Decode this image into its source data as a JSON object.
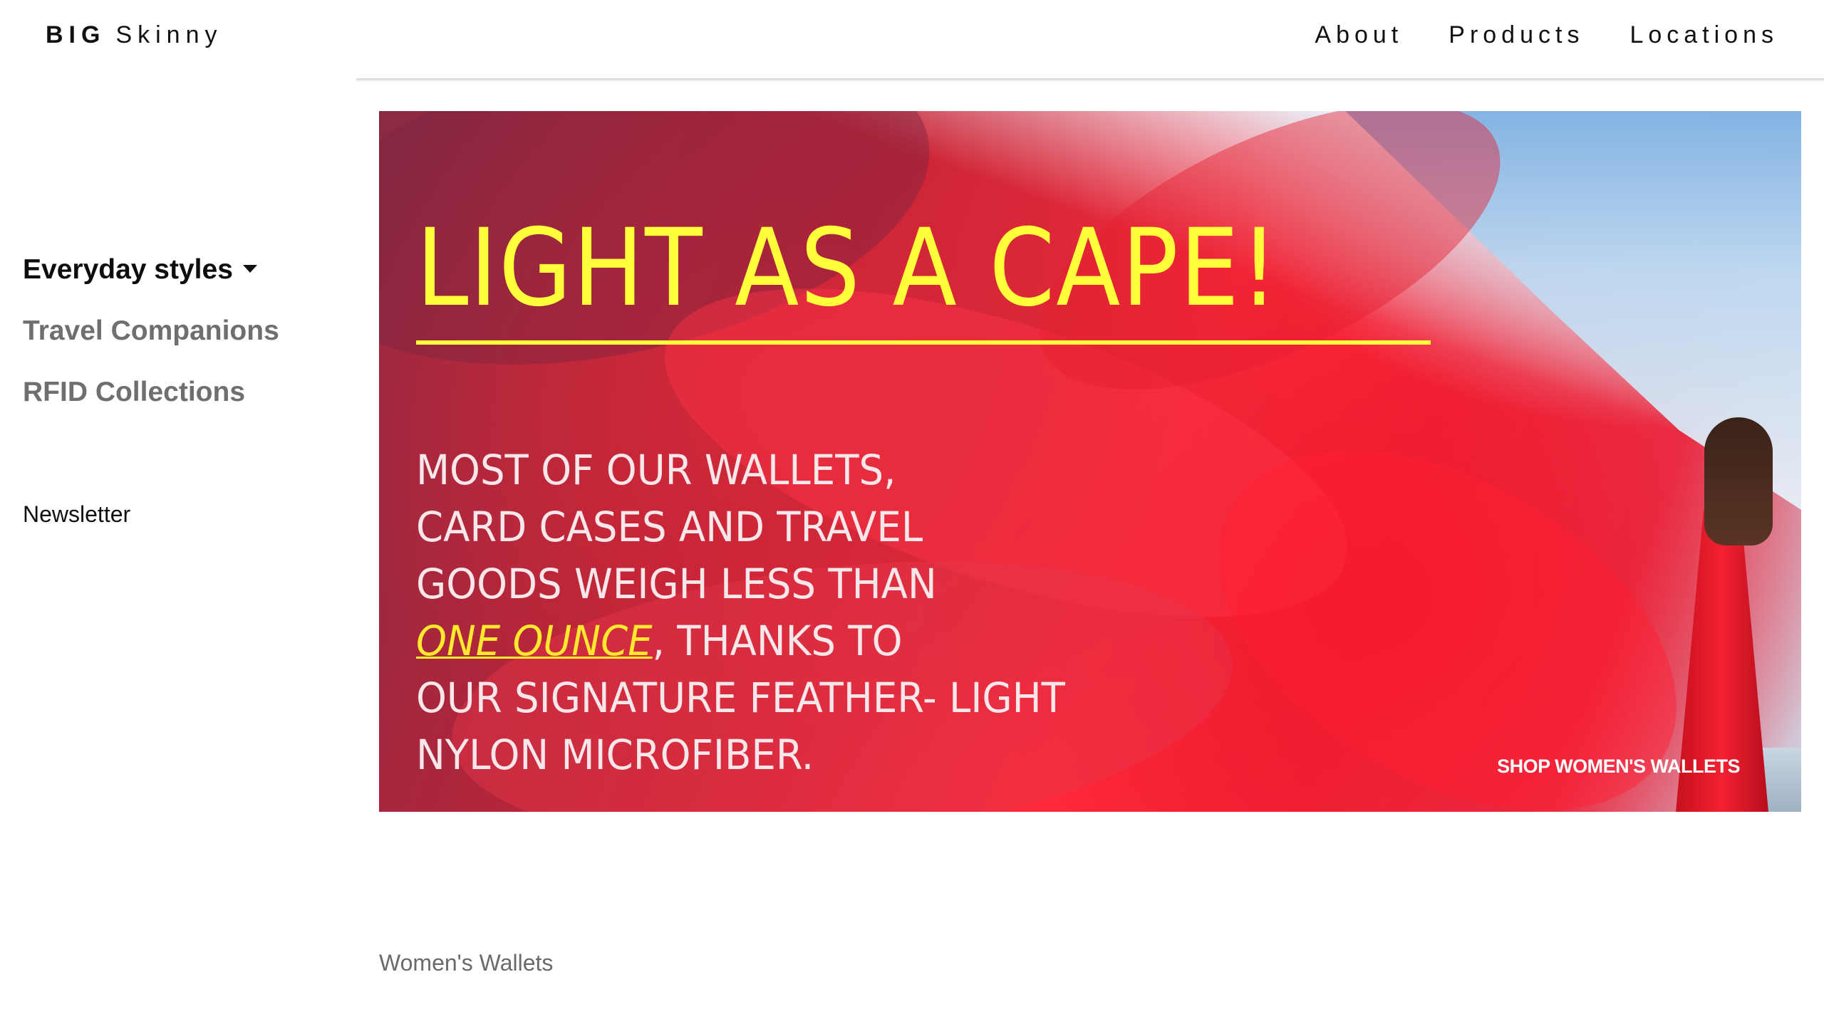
{
  "header": {
    "brand_bold": "BIG",
    "brand_rest": "Skinny",
    "nav": [
      {
        "label": "About"
      },
      {
        "label": "Products"
      },
      {
        "label": "Locations"
      }
    ]
  },
  "sidebar": {
    "items": [
      {
        "label": "Everyday styles",
        "active": true
      },
      {
        "label": "Travel Companions",
        "active": false
      },
      {
        "label": "RFID Collections",
        "active": false
      }
    ],
    "newsletter": "Newsletter"
  },
  "hero": {
    "title": "LIGHT AS A CAPE!",
    "body_lines": [
      "MOST OF OUR WALLETS,",
      "CARD CASES AND TRAVEL",
      "GOODS WEIGH LESS THAN"
    ],
    "highlight": "ONE OUNCE",
    "after_highlight": ", THANKS TO",
    "body_lines_end": [
      "OUR SIGNATURE FEATHER- LIGHT",
      "NYLON MICROFIBER."
    ],
    "cta": "SHOP  WOMEN'S WALLETS",
    "colors": {
      "title": "#ffff3c",
      "highlight": "#ffe92e",
      "fabric": "#ff2a3b"
    }
  },
  "caption": "Women's Wallets"
}
